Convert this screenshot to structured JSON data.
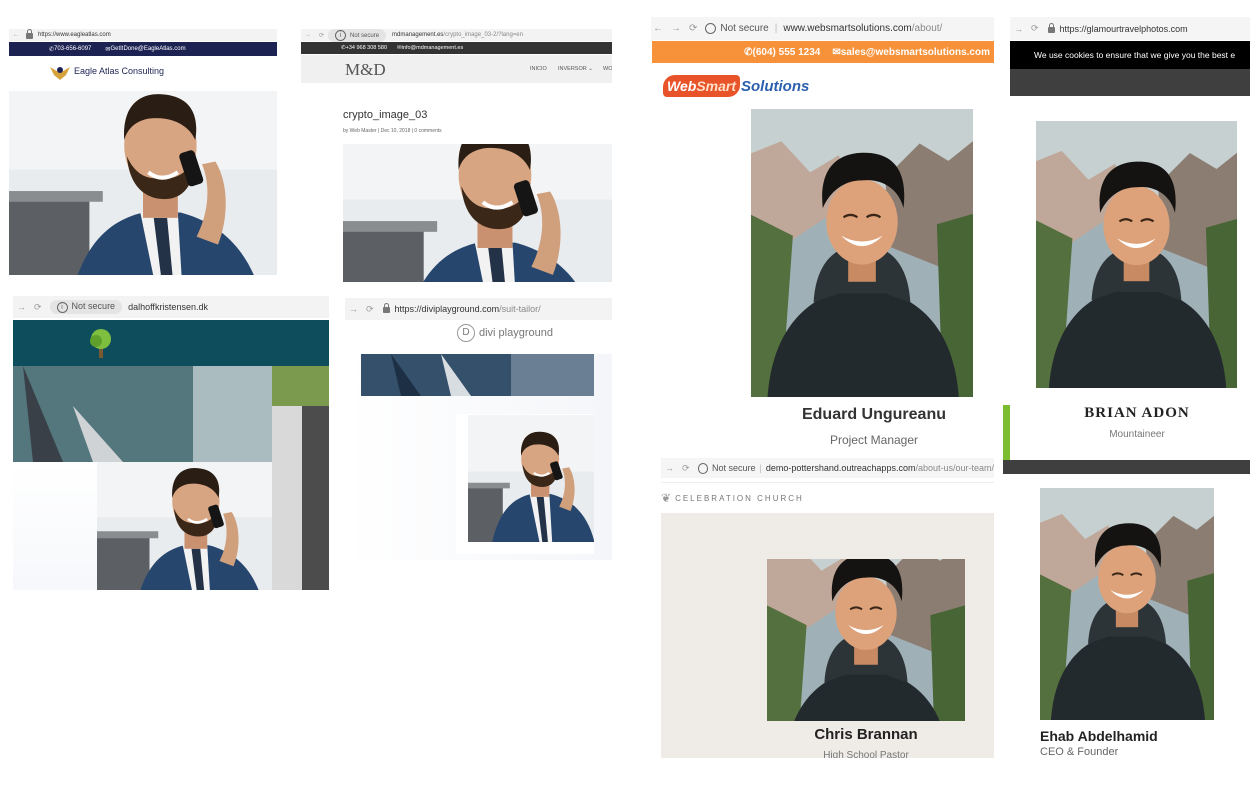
{
  "eagle": {
    "url": "https://www.eagleatlas.com",
    "phone": "703-656-6097",
    "email": "GetItDone@EagleAtlas.com",
    "logo_text": "Eagle Atlas Consulting"
  },
  "md": {
    "security": "Not secure",
    "url_host": "mdmanagement.es",
    "url_path": "/crypto_image_03-2/?lang=en",
    "phone": "+34 968 308 580",
    "email": "info@mdmanagement.es",
    "logo_text": "M&D",
    "nav": [
      "INICIO",
      "INVERSOR",
      "WO"
    ],
    "post_title": "crypto_image_03",
    "post_meta": "by Web Master | Dec 10, 2018 | 0 comments"
  },
  "dal": {
    "security": "Not secure",
    "url": "dalhoffkristensen.dk"
  },
  "divi": {
    "url_host": "https://diviplayground.com",
    "url_path": "/suit-tailor/",
    "logo_letter": "D",
    "logo_text": "divi playground"
  },
  "websmart": {
    "security": "Not secure",
    "url_host": "www.websmartsolutions.com",
    "url_path": "/about/",
    "phone": "(604) 555 1234",
    "email": "sales@websmartsolutions.com",
    "logo_web": "Web",
    "logo_smart": "Smart",
    "logo_solutions": "Solutions",
    "person_name": "Eduard Ungureanu",
    "person_role": "Project Manager"
  },
  "glamour": {
    "url": "https://glamourtravelphotos.com",
    "cookie_text": "We use cookies to ensure that we give you the best e",
    "person_name": "BRIAN ADON",
    "person_role": "Mountaineer"
  },
  "celebration": {
    "security": "Not secure",
    "url_host": "demo-pottershand.outreachapps.com",
    "url_path": "/about-us/our-team/",
    "logo_text": "CELEBRATION CHURCH",
    "person_name": "Chris Brannan",
    "person_role": "High School Pastor"
  },
  "ehab": {
    "person_name": "Ehab Abdelhamid",
    "person_role": "CEO & Founder"
  },
  "colors": {
    "eagle_navy": "#1c2353",
    "md_dark": "#333333",
    "teal": "#0e4d5c",
    "orange": "#f7923a",
    "websmart_blue": "#2b5fae"
  }
}
